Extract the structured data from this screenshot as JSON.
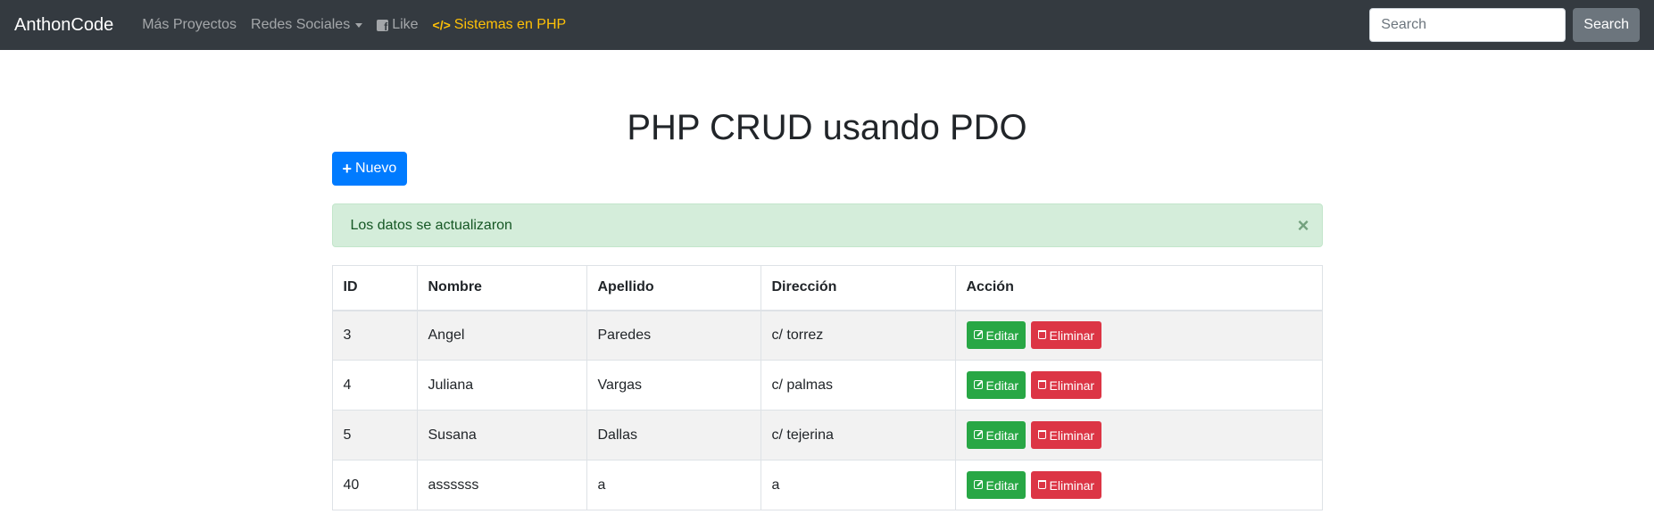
{
  "navbar": {
    "brand": "AnthonCode",
    "links": [
      {
        "label": "Más Proyectos"
      },
      {
        "label": "Redes Sociales"
      },
      {
        "label": "Like",
        "icon": "facebook-icon"
      },
      {
        "label": "Sistemas en PHP",
        "icon": "code-icon"
      }
    ],
    "search": {
      "placeholder": "Search",
      "value": "",
      "button": "Search"
    }
  },
  "main": {
    "title": "PHP CRUD usando PDO",
    "new_button": "Nuevo",
    "alert": {
      "message": "Los datos se actualizaron",
      "close": "×"
    }
  },
  "table": {
    "headers": [
      "ID",
      "Nombre",
      "Apellido",
      "Dirección",
      "Acción"
    ],
    "rows": [
      {
        "id": "3",
        "nombre": "Angel",
        "apellido": "Paredes",
        "direccion": "c/ torrez"
      },
      {
        "id": "4",
        "nombre": "Juliana",
        "apellido": "Vargas",
        "direccion": "c/ palmas"
      },
      {
        "id": "5",
        "nombre": "Susana",
        "apellido": "Dallas",
        "direccion": "c/ tejerina"
      },
      {
        "id": "40",
        "nombre": "assssss",
        "apellido": "a",
        "direccion": "a"
      }
    ],
    "actions": {
      "edit": "Editar",
      "delete": "Eliminar"
    }
  },
  "colors": {
    "navbar_bg": "#343a40",
    "accent_link": "#ffc107",
    "primary": "#007bff",
    "success": "#28a745",
    "danger": "#dc3545",
    "alert_bg": "#d4edda"
  }
}
